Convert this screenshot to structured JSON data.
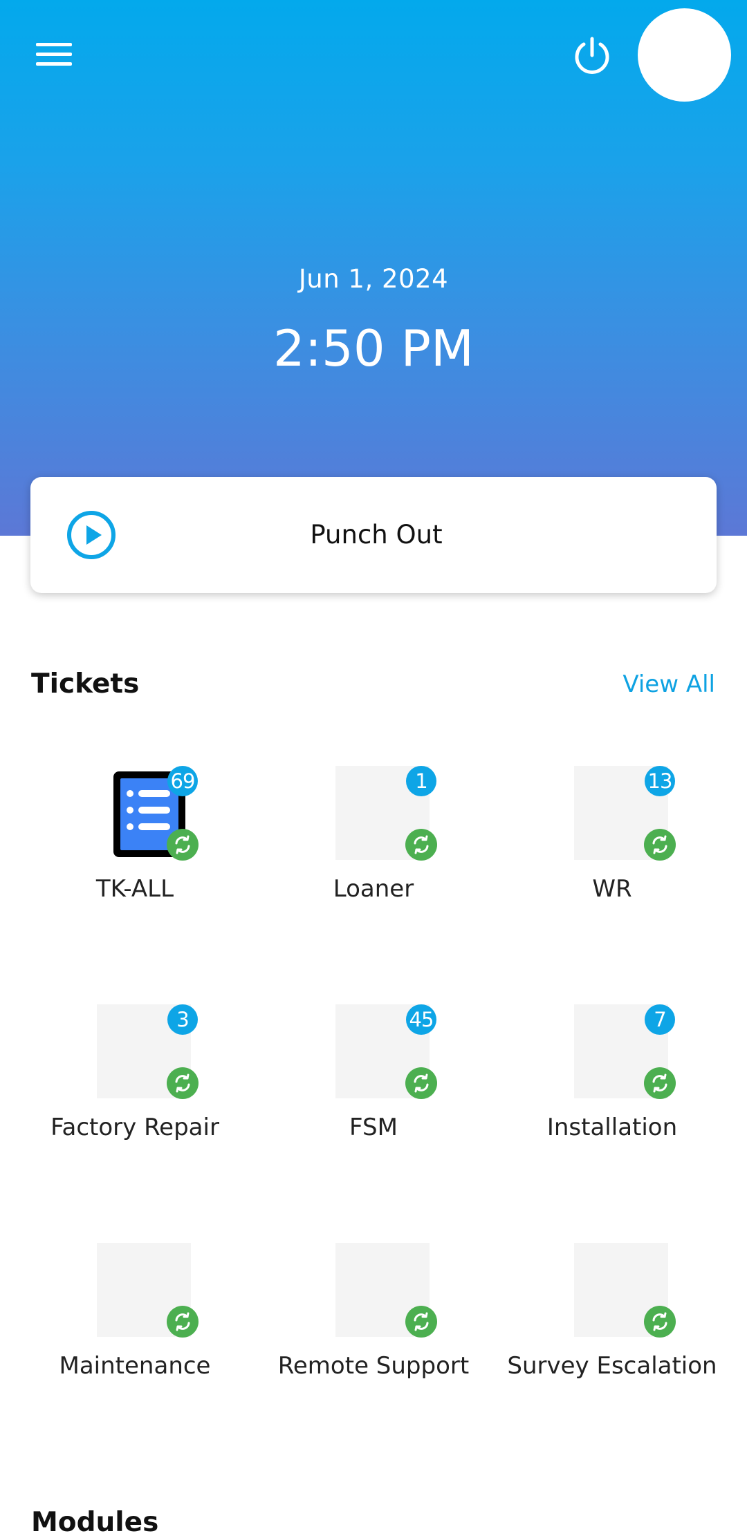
{
  "header": {
    "date": "Jun 1, 2024",
    "time": "2:50 PM"
  },
  "punch": {
    "label": "Punch Out"
  },
  "tickets": {
    "title": "Tickets",
    "view_all": "View All",
    "items": [
      {
        "label": "TK-ALL",
        "count": "69"
      },
      {
        "label": "Loaner",
        "count": "1"
      },
      {
        "label": "WR",
        "count": "13"
      },
      {
        "label": "Factory Repair",
        "count": "3"
      },
      {
        "label": "FSM",
        "count": "45"
      },
      {
        "label": "Installation",
        "count": "7"
      },
      {
        "label": "Maintenance",
        "count": ""
      },
      {
        "label": "Remote Support",
        "count": ""
      },
      {
        "label": "Survey Escalation",
        "count": ""
      }
    ]
  },
  "modules": {
    "title": "Modules"
  },
  "colors": {
    "accent": "#03a9ec",
    "sync_green": "#4caf50",
    "badge_blue": "#0ea5e6"
  },
  "icons": [
    "menu-icon",
    "power-icon",
    "play-circle-icon",
    "list-document-icon",
    "sync-icon"
  ]
}
